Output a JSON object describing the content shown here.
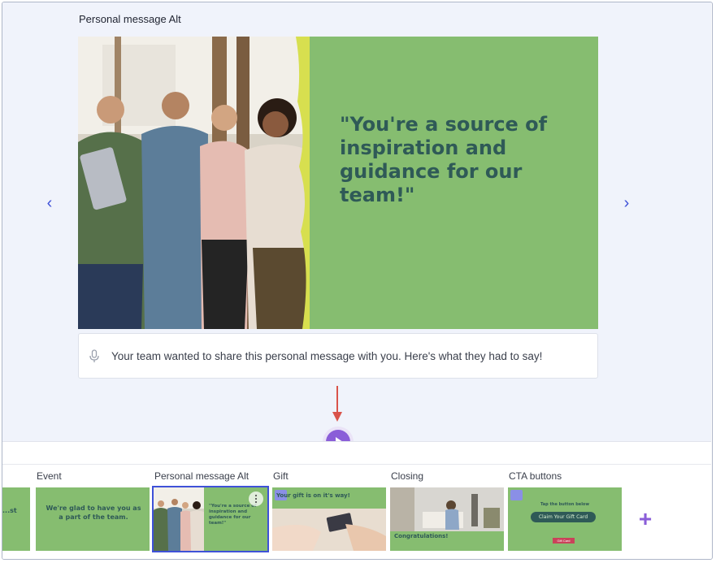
{
  "editor": {
    "slide_title": "Personal message Alt",
    "quote": "\"You're a source of inspiration and guidance for our team!\"",
    "caption": "Your team wanted to share this personal message with you. Here's what they had to say!",
    "colors": {
      "slide_bg": "#86bd70",
      "quote_text": "#2f5a57",
      "accent": "#3f51d8",
      "play": "#8a5ed8",
      "arrow": "#d9534a"
    }
  },
  "timeline": {
    "slides": [
      {
        "label": "",
        "text": "...st"
      },
      {
        "label": "Event",
        "text": "We're glad to have you as a part of the team."
      },
      {
        "label": "Personal message Alt",
        "text": "\"You're a source of inspiration and guidance for our team!\"",
        "selected": true
      },
      {
        "label": "Gift",
        "text": "Your gift is on it's way!"
      },
      {
        "label": "Closing",
        "text": "Congratulations!"
      },
      {
        "label": "CTA buttons",
        "text": "Tap the button below",
        "button": "Claim Your Gift Card",
        "badge": "Gift Card"
      }
    ],
    "add_icon": "plus-icon"
  }
}
